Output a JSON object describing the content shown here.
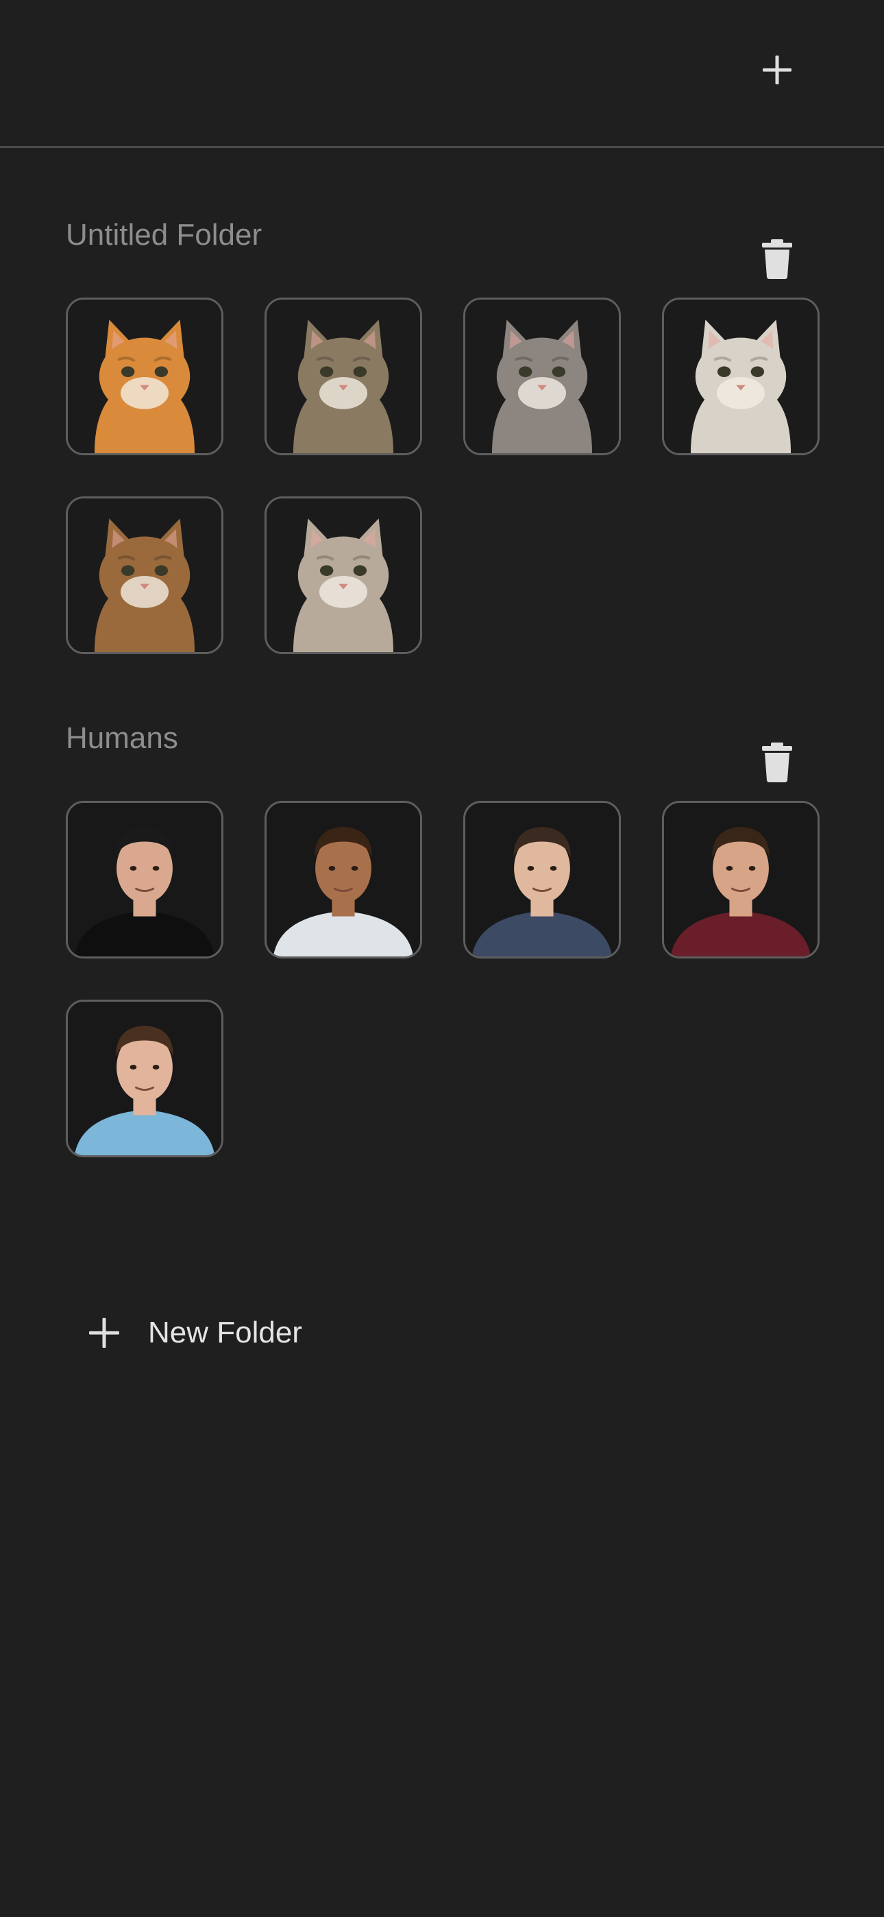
{
  "header": {
    "add_icon": "plus-icon"
  },
  "folders": [
    {
      "title": "Untitled Folder",
      "delete_icon": "trash-icon",
      "items": [
        {
          "label": "orange-cat-stretching",
          "type": "cat",
          "fur": "#d98a3a",
          "bg": "#1b1b1b"
        },
        {
          "label": "tabby-cat",
          "type": "cat",
          "fur": "#8a7a62",
          "bg": "#1b1b1b"
        },
        {
          "label": "sitting-grey-cat",
          "type": "cat",
          "fur": "#8c8580",
          "bg": "#1b1b1b"
        },
        {
          "label": "white-grey-cat",
          "type": "cat",
          "fur": "#d9d2c8",
          "bg": "#1b1b1b"
        },
        {
          "label": "brown-tabby-cat",
          "type": "cat",
          "fur": "#9a6a3c",
          "bg": "#1b1b1b"
        },
        {
          "label": "blue-eyed-tabby-cat",
          "type": "cat",
          "fur": "#b8aa9a",
          "bg": "#1b1b1b"
        }
      ]
    },
    {
      "title": "Humans",
      "delete_icon": "trash-icon",
      "items": [
        {
          "label": "man-black-cap",
          "type": "person",
          "skin": "#d9a88f",
          "hair": "#1a1a1a",
          "shirt": "#0f0f0f"
        },
        {
          "label": "man-curly-hair",
          "type": "person",
          "skin": "#a8714c",
          "hair": "#3a2416",
          "shirt": "#dfe4e8"
        },
        {
          "label": "man-navy-shirt",
          "type": "person",
          "skin": "#e0b89e",
          "hair": "#3b2a1f",
          "shirt": "#3c4a63"
        },
        {
          "label": "man-maroon-shirt",
          "type": "person",
          "skin": "#d8a487",
          "hair": "#3a2519",
          "shirt": "#6a1e2a"
        },
        {
          "label": "man-blue-shirt",
          "type": "person",
          "skin": "#e2b49c",
          "hair": "#4a3020",
          "shirt": "#7cb6d8"
        }
      ]
    }
  ],
  "new_folder": {
    "label": "New Folder",
    "icon": "plus-icon"
  },
  "colors": {
    "background": "#1f1f1f",
    "divider": "#4a4a4a",
    "folder_title": "#8d8d8d",
    "tile_border": "#5e5e5e",
    "icon": "#e0e0e0"
  }
}
